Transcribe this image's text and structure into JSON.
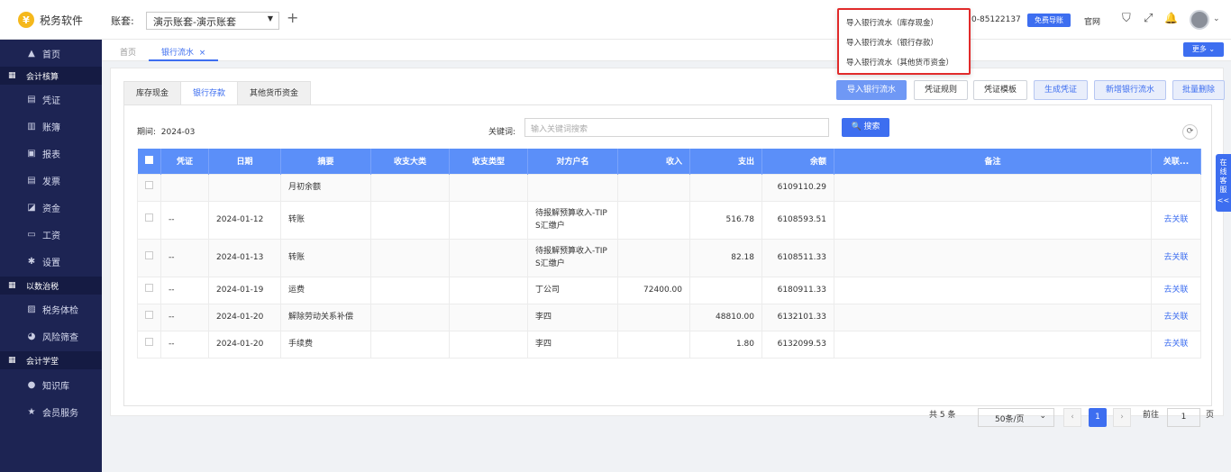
{
  "app": {
    "logo_glyph": "¥",
    "name": "税务软件"
  },
  "account": {
    "label": "账套:",
    "value": "演示账套-演示账套",
    "caret": "▼",
    "add_glyph": "+"
  },
  "header": {
    "phone": "0-85122137",
    "free_guide_label": "免费导账",
    "gov_label": "官网",
    "icons": [
      "shirt-icon",
      "expand-icon",
      "bell-icon",
      "avatar"
    ],
    "icon_glyphs": {
      "shirt": "⛉",
      "expand": "⤢",
      "bell": "🔔",
      "chevron": "⌄"
    }
  },
  "sidebar": {
    "items": [
      {
        "label": "首页",
        "icon": "▲"
      },
      {
        "group": "会计核算",
        "icon": "▦"
      },
      {
        "label": "凭证",
        "icon": "▤"
      },
      {
        "label": "账簿",
        "icon": "▥"
      },
      {
        "label": "报表",
        "icon": "▣"
      },
      {
        "label": "发票",
        "icon": "▤"
      },
      {
        "label": "资金",
        "icon": "◪"
      },
      {
        "label": "工资",
        "icon": "▭"
      },
      {
        "label": "设置",
        "icon": "✱"
      },
      {
        "group": "以数治税",
        "icon": "▦"
      },
      {
        "label": "税务体检",
        "icon": "▨"
      },
      {
        "label": "风险筛查",
        "icon": "◕"
      },
      {
        "group": "会计学堂",
        "icon": "▦"
      },
      {
        "label": "知识库",
        "icon": "●"
      },
      {
        "label": "会员服务",
        "icon": "★"
      }
    ]
  },
  "tabs": {
    "home": "首页",
    "current": "银行流水",
    "close": "×",
    "more": "更多 ⌄"
  },
  "subtabs": [
    "库存现金",
    "银行存款",
    "其他货币资金"
  ],
  "actions": {
    "import_flow": "导入银行流水",
    "voucher_rule": "凭证规则",
    "voucher_template": "凭证模板",
    "gen_voucher": "生成凭证",
    "add_flow": "新增银行流水",
    "batch_delete": "批量删除"
  },
  "dropdown": {
    "items": [
      "导入银行流水（库存现金）",
      "导入银行流水（银行存款）",
      "导入银行流水（其他货币资金）"
    ]
  },
  "filters": {
    "period_label": "期间:",
    "period_value": "2024-03",
    "keyword_label": "关键词:",
    "keyword_placeholder": "输入关键词搜索",
    "search_label": "🔍 搜索",
    "refresh_glyph": "⟳"
  },
  "table": {
    "headers": [
      "凭证",
      "日期",
      "摘要",
      "收支大类",
      "收支类型",
      "对方户名",
      "收入",
      "支出",
      "余额",
      "备注",
      "关联..."
    ],
    "rows": [
      {
        "voucher": "",
        "date": "",
        "summary": "月初余额",
        "cat": "",
        "type": "",
        "party": "",
        "income": "",
        "expense": "",
        "balance": "6109110.29",
        "note": "",
        "link": ""
      },
      {
        "voucher": "--",
        "date": "2024-01-12",
        "summary": "转账",
        "cat": "",
        "type": "",
        "party": "待报解预算收入-TIPS汇缴户",
        "income": "",
        "expense": "516.78",
        "balance": "6108593.51",
        "note": "",
        "link": "去关联"
      },
      {
        "voucher": "--",
        "date": "2024-01-13",
        "summary": "转账",
        "cat": "",
        "type": "",
        "party": "待报解预算收入-TIPS汇缴户",
        "income": "",
        "expense": "82.18",
        "balance": "6108511.33",
        "note": "",
        "link": "去关联"
      },
      {
        "voucher": "--",
        "date": "2024-01-19",
        "summary": "运费",
        "cat": "",
        "type": "",
        "party": "丁公司",
        "income": "72400.00",
        "expense": "",
        "balance": "6180911.33",
        "note": "",
        "link": "去关联"
      },
      {
        "voucher": "--",
        "date": "2024-01-20",
        "summary": "解除劳动关系补偿",
        "cat": "",
        "type": "",
        "party": "李四",
        "income": "",
        "expense": "48810.00",
        "balance": "6132101.33",
        "note": "",
        "link": "去关联"
      },
      {
        "voucher": "--",
        "date": "2024-01-20",
        "summary": "手续费",
        "cat": "",
        "type": "",
        "party": "李四",
        "income": "",
        "expense": "1.80",
        "balance": "6132099.53",
        "note": "",
        "link": "去关联"
      }
    ]
  },
  "pagination": {
    "total": "共 5 条",
    "page_size": "50条/页",
    "page_size_caret": "⌄",
    "prev": "‹",
    "current": "1",
    "next": "›",
    "goto_label": "前往",
    "goto_value": "1",
    "page_suffix": "页"
  },
  "service": {
    "label": "在线客服",
    "collapse": "<<"
  }
}
